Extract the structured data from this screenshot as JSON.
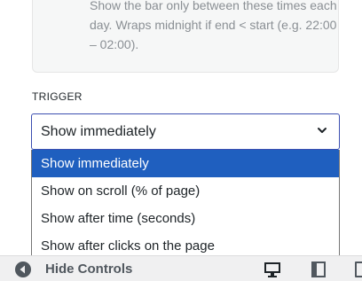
{
  "help": {
    "text": "Show the bar only between these times each day. Wraps midnight if end < start (e.g. 22:00 – 02:00)."
  },
  "trigger": {
    "label": "TRIGGER",
    "selected": "Show immediately",
    "options": [
      "Show immediately",
      "Show on scroll (% of page)",
      "Show after time (seconds)",
      "Show after clicks on the page"
    ]
  },
  "footer": {
    "hide_controls_label": "Hide Controls",
    "icons": [
      "collapse-arrow-icon",
      "desktop-preview-icon",
      "tablet-preview-icon",
      "mobile-preview-icon"
    ]
  },
  "colors": {
    "accent": "#1f5fbf",
    "select_border": "#3c4fb1",
    "help_text": "#8a8f94"
  }
}
